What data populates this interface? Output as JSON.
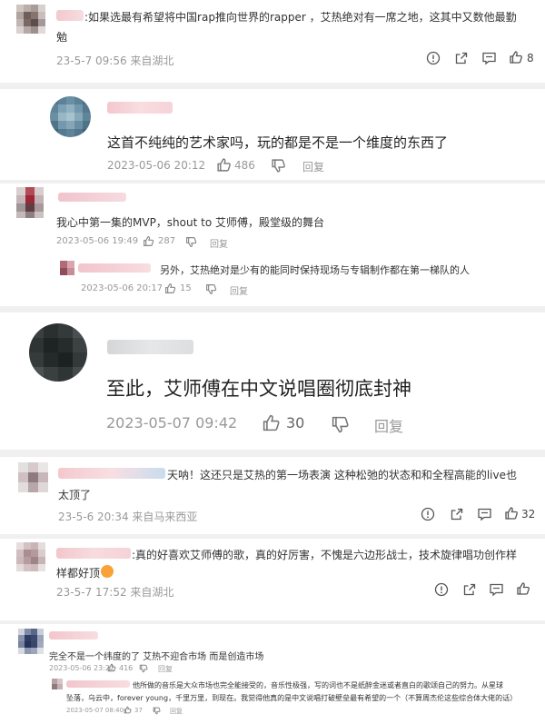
{
  "p1": {
    "text": ":如果选最有希望将中国rap推向世界的rapper ，艾热绝对有一席之地，这其中又数他最勤",
    "text2": "勉",
    "meta": "23-5-7 09:56 来自湖北",
    "likes": "8"
  },
  "p2": {
    "text": "这首不纯纯的艺术家吗，玩的都是不是一个维度的东西了",
    "date": "2023-05-06 20:12",
    "likes": "486",
    "reply": "回复"
  },
  "p3": {
    "text": "我心中第一集的MVP，shout to 艾师傅，殿堂级的舞台",
    "date": "2023-05-06 19:49",
    "likes": "287",
    "reply": "回复",
    "sub_text": "另外，艾热绝对是少有的能同时保持现场与专辑制作都在第一梯队的人",
    "sub_date": "2023-05-06 20:17",
    "sub_likes": "15",
    "sub_reply": "回复"
  },
  "p4": {
    "text": "至此，艾师傅在中文说唱圈彻底封神",
    "date": "2023-05-07 09:42",
    "likes": "30",
    "reply": "回复"
  },
  "p5": {
    "text": "天呐！这还只是艾热的第一场表演 这种松弛的状态和和全程高能的live也",
    "text2": "太顶了",
    "meta": "23-5-6 20:34 来自马来西亚",
    "likes": "32"
  },
  "p6": {
    "text": ":真的好喜欢艾师傅的歌，真的好厉害，不愧是六边形战士，技术旋律唱功创作样",
    "text2": "样都好顶",
    "meta": "23-5-7 17:52 来自湖北",
    "likes": ""
  },
  "p7": {
    "text": "完全不是一个纬度的了 艾热不迎合市场 而是创造市场",
    "date": "2023-05-06 23:22",
    "likes": "416",
    "reply": "回复",
    "sub_text": "他所做的音乐是大众市场也完全能接受的，音乐性极强，写的词也不是纸醉金迷或者直白的歌颂自己的努力。从星球",
    "sub_text2": "坠落，乌云中，forever young，千里万里，到现在。我觉得他真的是中文说唱打破壁垒最有希望的一个（不算周杰伦这些综合体大佬的话）",
    "sub_date": "2023-05-07 08:40",
    "sub_likes": "37",
    "sub_reply": "回复"
  },
  "colors": {
    "meta": "#999999",
    "text": "#333333",
    "separator": "#f0f0f0",
    "orange": "#f9a23a"
  }
}
